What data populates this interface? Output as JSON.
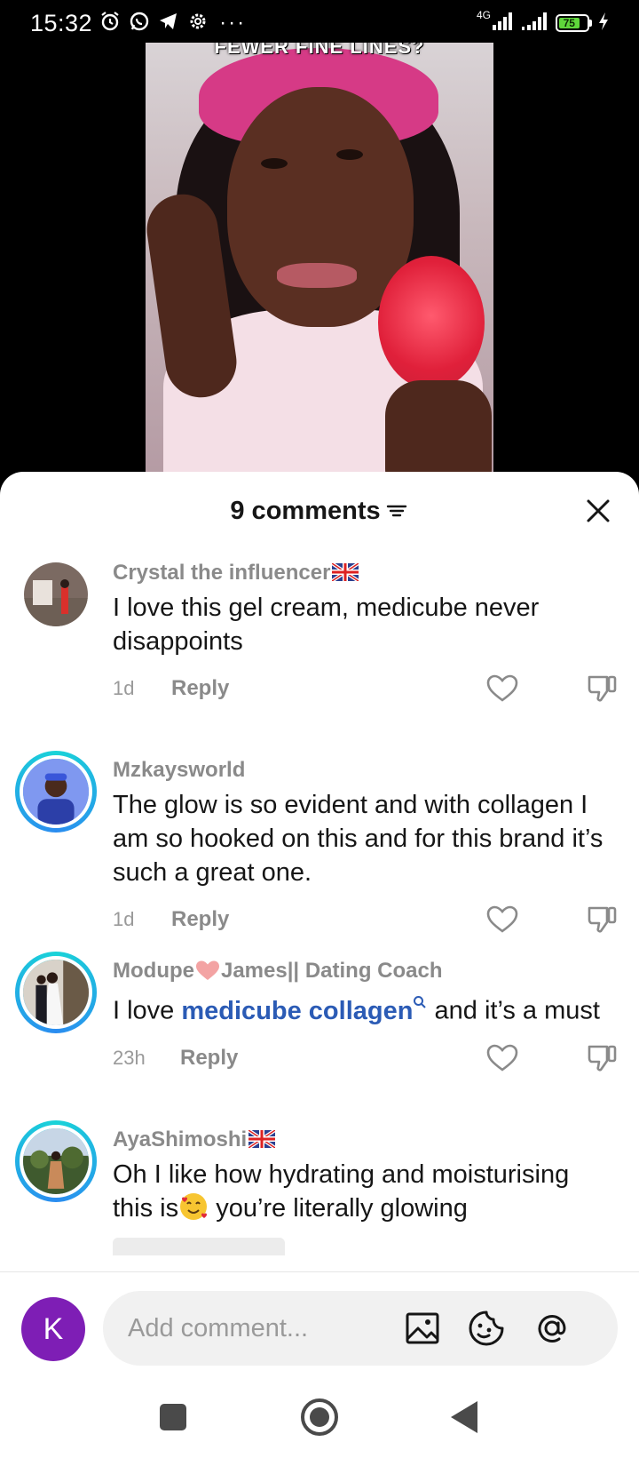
{
  "status_bar": {
    "time": "15:32",
    "network": "4G",
    "battery": "75",
    "battery_level": 0.75,
    "icons": [
      "alarm-icon",
      "whatsapp-icon",
      "telegram-icon",
      "settings-icon",
      "more-icon",
      "signal-icon",
      "signal-icon",
      "battery-icon",
      "charging-icon"
    ],
    "more": "···"
  },
  "video": {
    "overlay_text": "FEWER FINE LINES?"
  },
  "comments_sheet": {
    "title": "9 comments",
    "filter_icon": "filter-icon",
    "close_icon": "close-icon"
  },
  "comments": [
    {
      "username": "Crystal the influencer",
      "username_suffix_icon": "uk-flag",
      "text": "I love this gel cream, medicube never disappoints",
      "age": "1d",
      "reply_label": "Reply"
    },
    {
      "username": "Mzkaysworld",
      "text": "The glow is so evident and with collagen I am so hooked on this and for this brand it’s such a great one.",
      "age": "1d",
      "reply_label": "Reply"
    },
    {
      "username_part1": "Modupe",
      "username_part2": "James|| Dating Coach",
      "username_icon": "heart-emoji",
      "text_before": "I love ",
      "link_text": "medicube collagen",
      "text_after": " and it’s a must",
      "age": "23h",
      "reply_label": "Reply"
    },
    {
      "username": "AyaShimoshi",
      "username_suffix_icon": "uk-flag",
      "text_before": "Oh I like how hydrating and moisturising this is",
      "emoji": "smiling-face-with-hearts-emoji",
      "text_after": " you’re literally glowing"
    }
  ],
  "composer": {
    "avatar_letter": "K",
    "avatar_color": "#7e1eb5",
    "placeholder": "Add comment...",
    "icons": [
      "image-icon",
      "emoji-icon",
      "mention-icon"
    ]
  },
  "navbar": {
    "icons": [
      "recents-icon",
      "home-icon",
      "back-icon"
    ]
  },
  "colors": {
    "link": "#2b5bb5",
    "ring_start": "#19d3d8",
    "ring_end": "#2a8cf0",
    "battery_fill": "#5fd63b"
  }
}
